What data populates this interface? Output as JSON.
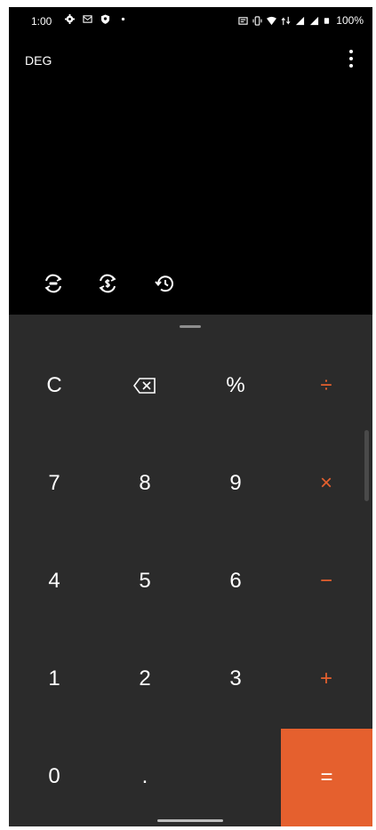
{
  "status_bar": {
    "time": "1:00",
    "battery_percent": "100%",
    "left_icons": [
      "settings-icon",
      "message-icon",
      "shield-icon",
      "dot-icon"
    ],
    "right_icons": [
      "cast-icon",
      "vibrate-icon",
      "wifi-icon",
      "data-icon",
      "signal-icon",
      "signal-icon",
      "battery-icon"
    ]
  },
  "display": {
    "angle_mode": "DEG",
    "tools": [
      "unit-converter-icon",
      "currency-converter-icon",
      "history-icon"
    ]
  },
  "keypad": {
    "rows": [
      [
        "C",
        "⌫",
        "%",
        "÷"
      ],
      [
        "7",
        "8",
        "9",
        "×"
      ],
      [
        "4",
        "5",
        "6",
        "−"
      ],
      [
        "1",
        "2",
        "3",
        "+"
      ],
      [
        "0",
        ".",
        "",
        "="
      ]
    ],
    "accent_color": "#e5602e"
  }
}
